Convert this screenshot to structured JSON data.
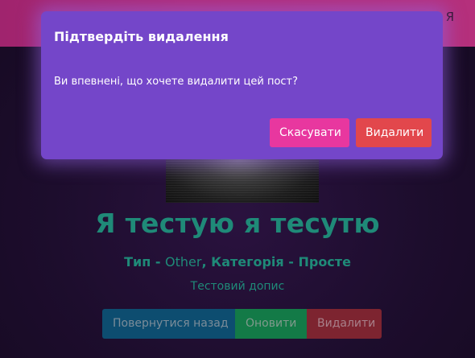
{
  "topbar": {
    "link_fragment": "Я"
  },
  "post": {
    "title": "Я тестую я тесутю",
    "meta_type_label": "Тип - ",
    "meta_type_value": "Other",
    "meta_separator": ", ",
    "meta_category_label": "Категорія - ",
    "meta_category_value": "Просте",
    "description": "Тестовий допис",
    "actions": {
      "back_label": "Повернутися назад",
      "update_label": "Оновити",
      "delete_label": "Видалити"
    }
  },
  "modal": {
    "title": "Підтвердіть видалення",
    "body": "Ви впевнені, що хочете видалити цей пост?",
    "cancel_label": "Скасувати",
    "confirm_label": "Видалити"
  },
  "colors": {
    "modal_bg": "#7446c9",
    "cancel_button": "#e8379f",
    "confirm_button": "#e2474c",
    "title_text": "#1f8a78",
    "topbar": "#b02a76"
  }
}
